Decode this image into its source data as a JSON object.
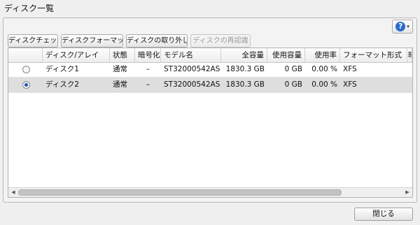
{
  "window": {
    "title": "ディスク一覧"
  },
  "help": {
    "icon": "help-icon",
    "symbol": "?",
    "caret": "▾"
  },
  "toolbar": {
    "disk_check": "ディスクチェック",
    "disk_format": "ディスクフォーマット",
    "disk_remove": "ディスクの取り外し",
    "disk_reauth": "ディスクの再認識"
  },
  "table": {
    "columns": [
      "",
      "ディスク/アレイ",
      "状態",
      "暗号化",
      "モデル名",
      "全容量",
      "使用容量",
      "使用率",
      "フォーマット形式",
      "暗"
    ],
    "rows": [
      {
        "selected": false,
        "name": "ディスク1",
        "status": "通常",
        "encryption": "–",
        "model": "ST32000542AS",
        "capacity": "1830.3 GB",
        "used": "0 GB",
        "usage": "0.00 %",
        "format": "XFS"
      },
      {
        "selected": true,
        "name": "ディスク2",
        "status": "通常",
        "encryption": "–",
        "model": "ST32000542AS",
        "capacity": "1830.3 GB",
        "used": "0 GB",
        "usage": "0.00 %",
        "format": "XFS"
      }
    ]
  },
  "scrollbar": {
    "left_arrow": "◀",
    "right_arrow": "▶"
  },
  "footer": {
    "close_label": "閉じる"
  }
}
